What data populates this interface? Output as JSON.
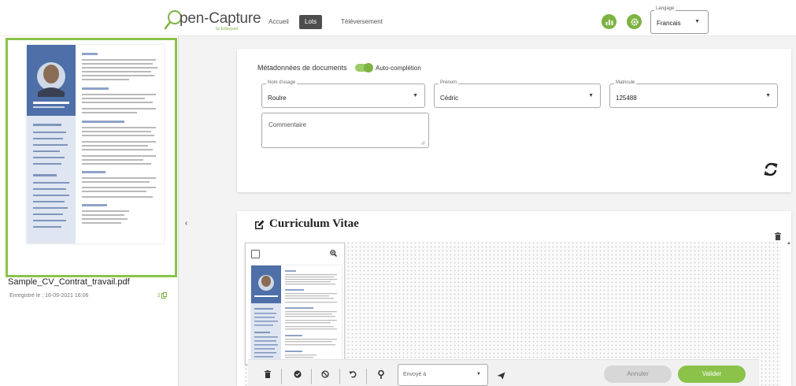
{
  "header": {
    "logo_text": "pen-Capture",
    "logo_subtitle": "by Edissyum",
    "nav": {
      "accueil": "Accueil",
      "lots": "Lots",
      "upload": "Téléversement"
    },
    "language": {
      "legend": "Langage",
      "value": "Francais"
    }
  },
  "colors": {
    "accent": "#7cb342",
    "accent_light": "#8bc34a",
    "nav_active": "#4e4e4e"
  },
  "left_panel": {
    "document": {
      "filename": "Sample_CV_Contrat_travail.pdf",
      "saved_label": "Enregistré le : 16-09-2021 16:06",
      "page_count": "2"
    },
    "collapse_icon": "chevron-left-icon"
  },
  "metadata": {
    "title": "Métadonnées de documents",
    "autocomplete": {
      "label": "Auto-complétion",
      "enabled": true
    },
    "fields": {
      "nom": {
        "legend": "Nom d'usage",
        "value": "Roulre"
      },
      "prenom": {
        "legend": "Prénom",
        "value": "Cédric"
      },
      "matricule": {
        "legend": "Matricule",
        "value": "125488"
      }
    },
    "comment_placeholder": "Commentaire",
    "refresh_icon": "sync-icon"
  },
  "viewer": {
    "title": "Curriculum Vitae",
    "title_icon": "edit-icon",
    "page": {
      "selected": false
    }
  },
  "toolbar": {
    "send_placeholder": "Envoyé à",
    "cancel_label": "Annuler",
    "validate_label": "Valider",
    "icons": [
      "trash-icon",
      "check-circle-icon",
      "ban-icon",
      "undo-icon",
      "key-icon",
      "send-icon"
    ]
  }
}
